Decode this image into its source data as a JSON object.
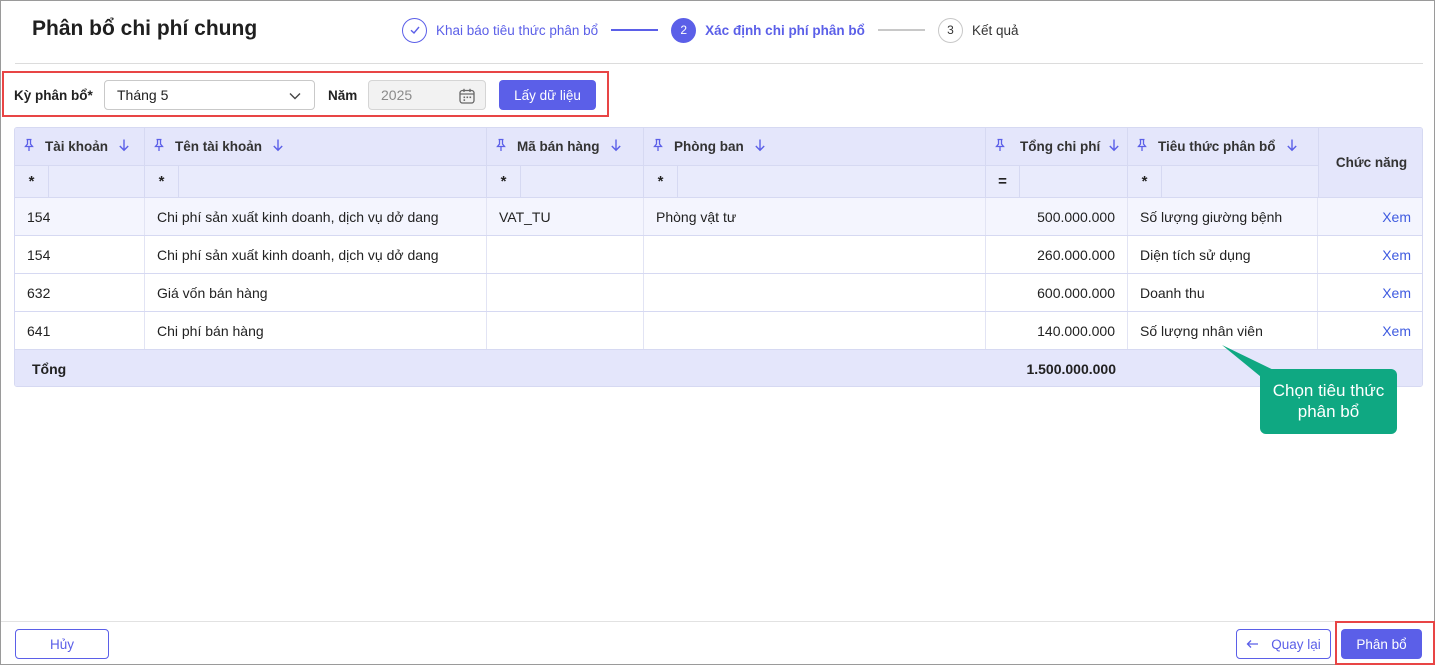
{
  "page": {
    "title": "Phân bổ chi phí chung"
  },
  "stepper": [
    {
      "num": "",
      "label": "Khai báo tiêu thức phân bổ",
      "state": "done"
    },
    {
      "num": "2",
      "label": "Xác định chi phí phân bổ",
      "state": "active"
    },
    {
      "num": "3",
      "label": "Kết quả",
      "state": "todo"
    }
  ],
  "filter": {
    "period_label": "Kỳ phân bổ*",
    "period_value": "Tháng 5",
    "year_label": "Năm",
    "year_value": "2025",
    "fetch_button": "Lấy dữ liệu"
  },
  "table": {
    "columns": [
      "Tài khoản",
      "Tên tài khoản",
      "Mã bán hàng",
      "Phòng ban",
      "Tổng chi phí",
      "Tiêu thức phân bổ"
    ],
    "action_column": "Chức năng",
    "filter_ops": [
      "*",
      "*",
      "*",
      "*",
      "=",
      "*"
    ],
    "rows": [
      {
        "account": "154",
        "name": "Chi phí sản xuất kinh doanh, dịch vụ dở dang",
        "sales_code": "VAT_TU",
        "department": "Phòng vật tư",
        "total": "500.000.000",
        "criteria": "Số lượng giường bệnh",
        "action": "Xem"
      },
      {
        "account": "154",
        "name": "Chi phí sản xuất kinh doanh, dịch vụ dở dang",
        "sales_code": "",
        "department": "",
        "total": "260.000.000",
        "criteria": "Diện tích sử dụng",
        "action": "Xem"
      },
      {
        "account": "632",
        "name": "Giá vốn bán hàng",
        "sales_code": "",
        "department": "",
        "total": "600.000.000",
        "criteria": "Doanh thu",
        "action": "Xem"
      },
      {
        "account": "641",
        "name": "Chi phí bán hàng",
        "sales_code": "",
        "department": "",
        "total": "140.000.000",
        "criteria": "Số lượng nhân viên",
        "action": "Xem"
      }
    ],
    "total_label": "Tổng",
    "total_value": "1.500.000.000"
  },
  "tooltip": {
    "text": "Chọn tiêu thức phân bổ"
  },
  "footer": {
    "cancel": "Hủy",
    "back": "Quay lại",
    "allocate": "Phân bổ"
  },
  "colors": {
    "primary": "#5b5fe8",
    "highlight": "#e84545",
    "tooltip": "#0fa882",
    "header_bg": "#e4e6fb"
  },
  "icons": {
    "pin": "pin-icon",
    "sort": "arrow-down-icon",
    "chevron": "chevron-down-icon",
    "calendar": "calendar-icon",
    "check": "check-icon",
    "back": "arrow-left-icon"
  }
}
